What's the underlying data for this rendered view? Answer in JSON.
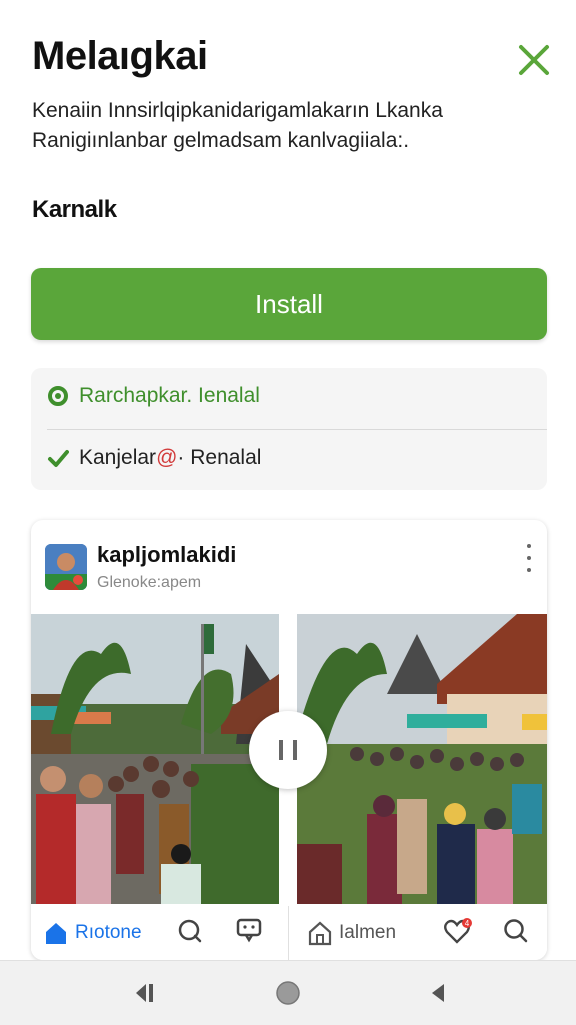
{
  "header": {
    "title": "Melaıgkai"
  },
  "description": {
    "line1": "Kenaiin Innsirlqipkanidarigamlakarın Lkanka",
    "line2": "Ranigiınlanbar gelmadsam kanlvagiiala:."
  },
  "subtitle": "Karnalk",
  "install_label": "Install",
  "features": [
    {
      "label": "Rarchapkar. Ienalal",
      "icon": "refresh-icon"
    },
    {
      "label_a": "Kanjelar",
      "label_b": "@",
      "label_c": "· Renalal",
      "icon": "check-icon"
    }
  ],
  "post": {
    "username": "kapljomlakidi",
    "subtext": "Glenoke:apem"
  },
  "bottom_tabs": {
    "home_label": "Rıotone",
    "second_label": "Ialmen",
    "badge": "4"
  },
  "colors": {
    "accent": "#5aa63a",
    "home_blue": "#1a73e8"
  }
}
